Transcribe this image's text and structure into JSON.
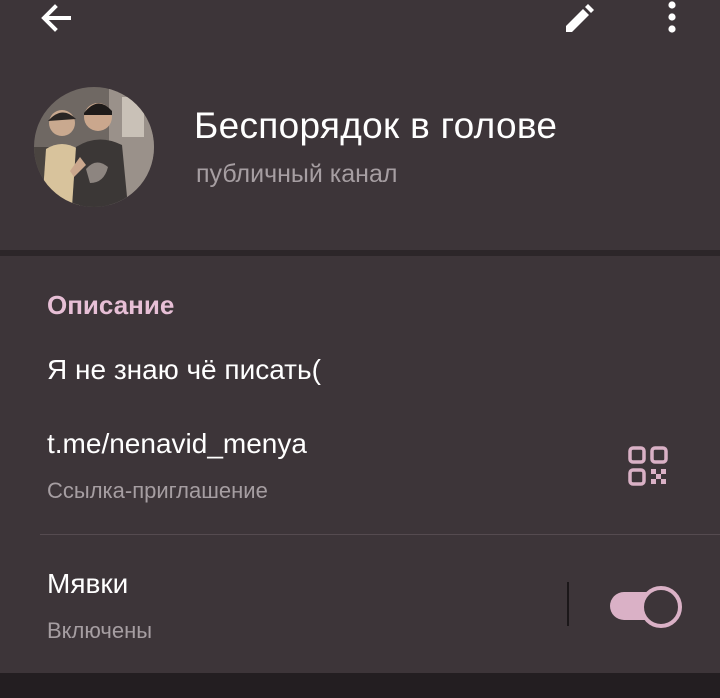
{
  "header": {
    "back_icon": "arrow-left-icon",
    "edit_icon": "pencil-icon",
    "more_icon": "more-vertical-icon",
    "title": "Беспорядок в голове",
    "subtitle": "публичный канал"
  },
  "info": {
    "section_label": "Описание",
    "description": "Я не знаю чё писать(",
    "link": "t.me/nenavid_menya",
    "link_caption": "Ссылка-приглашение",
    "qr_icon": "qr-code-icon"
  },
  "notifications": {
    "label": "Мявки",
    "status": "Включены",
    "enabled": true
  },
  "colors": {
    "background": "#3d3539",
    "accent": "#e7bfd6",
    "toggle": "#dab1c6",
    "secondary_text": "#a69ea2"
  }
}
